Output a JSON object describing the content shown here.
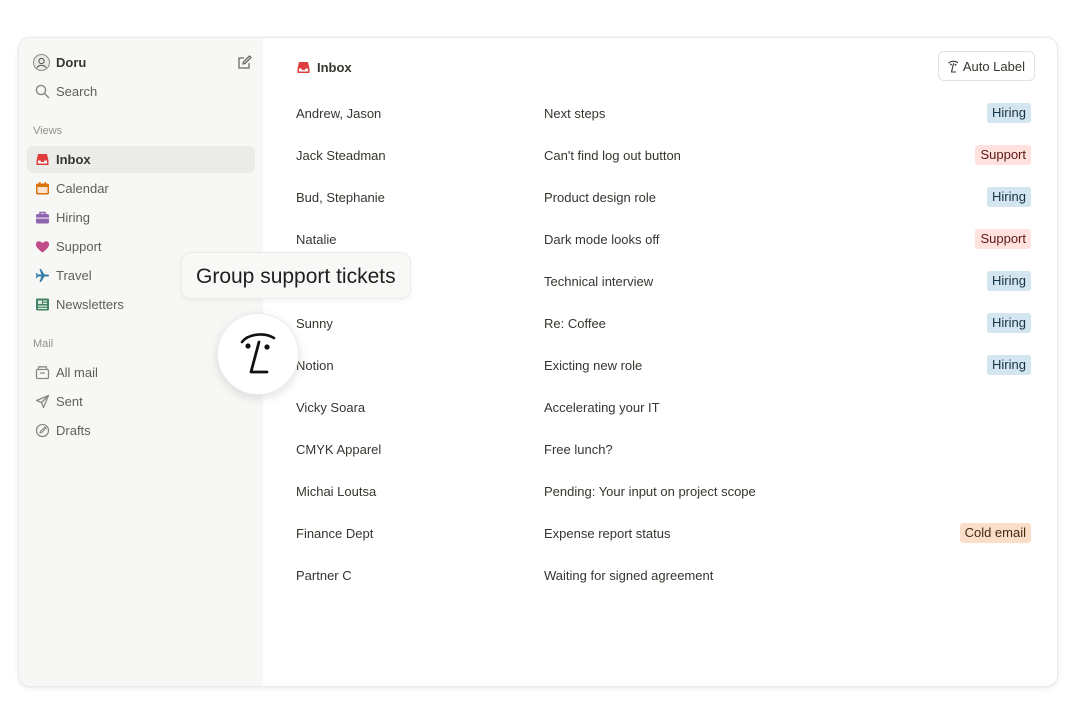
{
  "user": {
    "name": "Doru"
  },
  "search": {
    "label": "Search"
  },
  "sections": {
    "views": "Views",
    "mail": "Mail"
  },
  "views": [
    {
      "label": "Inbox",
      "icon": "inbox-icon",
      "color": "#e03e3e",
      "active": true
    },
    {
      "label": "Calendar",
      "icon": "calendar-icon",
      "color": "#d9730d"
    },
    {
      "label": "Hiring",
      "icon": "briefcase-icon",
      "color": "#9065b0"
    },
    {
      "label": "Support",
      "icon": "heart-icon",
      "color": "#c14c8a"
    },
    {
      "label": "Travel",
      "icon": "airplane-icon",
      "color": "#337ea9"
    },
    {
      "label": "Newsletters",
      "icon": "newspaper-icon",
      "color": "#448361"
    }
  ],
  "mail": [
    {
      "label": "All mail",
      "icon": "archive-icon"
    },
    {
      "label": "Sent",
      "icon": "send-icon"
    },
    {
      "label": "Drafts",
      "icon": "draft-icon"
    }
  ],
  "main": {
    "title": "Inbox",
    "auto_label": "Auto Label"
  },
  "tags": {
    "Hiring": {
      "bg": "#d3e5ef",
      "fg": "#183347"
    },
    "Support": {
      "bg": "#ffe2dd",
      "fg": "#5d1715"
    },
    "Cold email": {
      "bg": "#fadec9",
      "fg": "#49290e"
    }
  },
  "messages": [
    {
      "sender": "Andrew, Jason",
      "subject": "Next steps",
      "tag": "Hiring"
    },
    {
      "sender": "Jack Steadman",
      "subject": "Can't find log out button",
      "tag": "Support"
    },
    {
      "sender": "Bud, Stephanie",
      "subject": "Product design role",
      "tag": "Hiring"
    },
    {
      "sender": "Natalie",
      "subject": "Dark mode looks off",
      "tag": "Support"
    },
    {
      "sender": "",
      "subject": "Technical interview",
      "tag": "Hiring"
    },
    {
      "sender": "Sunny",
      "subject": "Re: Coffee",
      "tag": "Hiring"
    },
    {
      "sender": "Notion",
      "subject": "Exicting new role",
      "tag": "Hiring"
    },
    {
      "sender": "Vicky Soara",
      "subject": "Accelerating your IT",
      "tag": ""
    },
    {
      "sender": "CMYK Apparel",
      "subject": "Free lunch?",
      "tag": ""
    },
    {
      "sender": "Michai Loutsa",
      "subject": "Pending: Your input on project scope",
      "tag": ""
    },
    {
      "sender": "Finance Dept",
      "subject": "Expense report status",
      "tag": "Cold email"
    },
    {
      "sender": "Partner C",
      "subject": "Waiting for signed agreement",
      "tag": ""
    }
  ],
  "tooltip": {
    "text": "Group support tickets"
  }
}
